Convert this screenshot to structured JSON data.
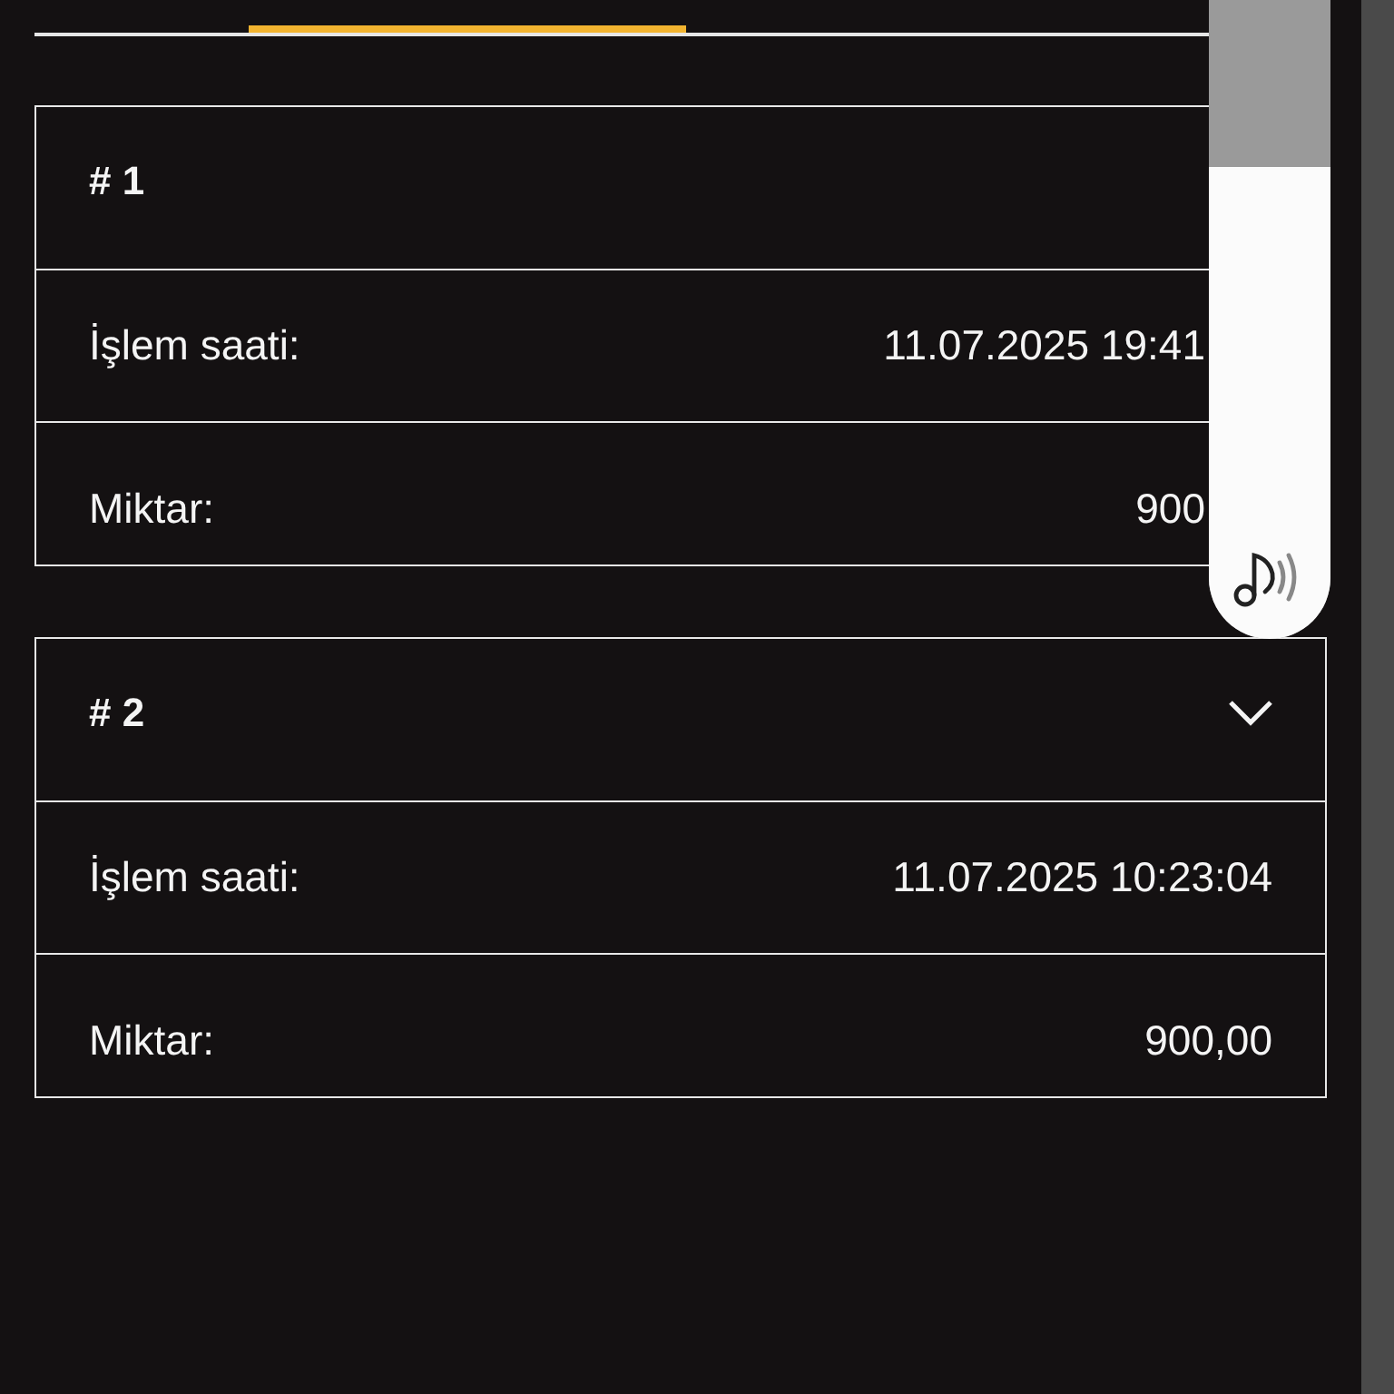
{
  "tabs": [
    {
      "selected": true
    }
  ],
  "transactions": [
    {
      "title": "# 1",
      "toggle": false,
      "rows": [
        {
          "label": "İşlem saati:",
          "value": "11.07.2025 19:41"
        },
        {
          "label": "Miktar:",
          "value": "900"
        }
      ]
    },
    {
      "title": "# 2",
      "toggle": true,
      "rows": [
        {
          "label": "İşlem saati:",
          "value": "11.07.2025 10:23:04"
        },
        {
          "label": "Miktar:",
          "value": "900,00"
        }
      ]
    }
  ],
  "volume_panel": {
    "level": 0.74
  }
}
